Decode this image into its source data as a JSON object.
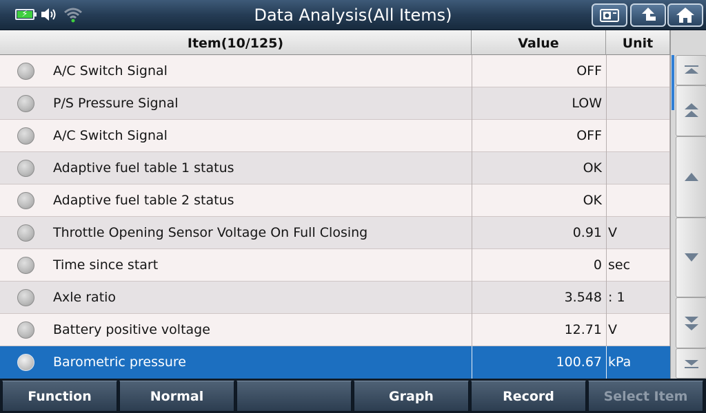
{
  "header": {
    "title": "Data Analysis(All Items)"
  },
  "table": {
    "columns": {
      "item": "Item(10/125)",
      "value": "Value",
      "unit": "Unit"
    },
    "rows": [
      {
        "name": "A/C Switch Signal",
        "value": "OFF",
        "unit": ""
      },
      {
        "name": "P/S Pressure Signal",
        "value": "LOW",
        "unit": ""
      },
      {
        "name": "A/C Switch Signal",
        "value": "OFF",
        "unit": ""
      },
      {
        "name": "Adaptive fuel table 1 status",
        "value": "OK",
        "unit": ""
      },
      {
        "name": "Adaptive fuel table 2 status",
        "value": "OK",
        "unit": ""
      },
      {
        "name": "Throttle Opening Sensor Voltage On Full Closing",
        "value": "0.91",
        "unit": "V"
      },
      {
        "name": "Time since start",
        "value": "0",
        "unit": "sec"
      },
      {
        "name": "Axle ratio",
        "value": "3.548",
        "unit": ": 1"
      },
      {
        "name": "Battery positive voltage",
        "value": "12.71",
        "unit": "V"
      },
      {
        "name": "Barometric pressure",
        "value": "100.67",
        "unit": "kPa"
      }
    ],
    "selected_row": 9
  },
  "footer": {
    "buttons": [
      "Function",
      "Normal",
      "",
      "Graph",
      "Record",
      "Select Item"
    ],
    "disabled": [
      false,
      false,
      false,
      false,
      false,
      true
    ]
  },
  "colors": {
    "selected_row": "#1c6fc0",
    "battery_fill": "#3fcf3f",
    "wifi": "#3fcf3f"
  }
}
